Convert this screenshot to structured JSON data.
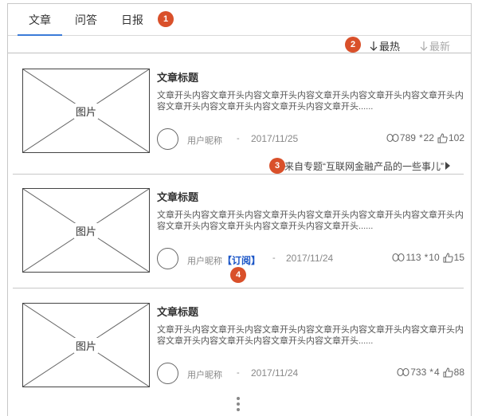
{
  "tabs": [
    {
      "label": "文章",
      "active": true
    },
    {
      "label": "问答",
      "active": false
    },
    {
      "label": "日报",
      "active": false
    }
  ],
  "markers": [
    "1",
    "2",
    "3",
    "4"
  ],
  "sort": {
    "hot_label": "最热",
    "new_label": "最新"
  },
  "articles": [
    {
      "image_label": "图片",
      "title": "文章标题",
      "excerpt": "文章开头内容文章开头内容文章开头内容文章开头内容文章开头内容文章开头内容文章开头内容文章开头内容文章开头内容文章开头......",
      "nickname": "用户昵称",
      "dash": "-",
      "date": "2017/11/25",
      "views": "789",
      "stars": "22",
      "likes": "102",
      "source": "来自专题“互联网金融产品的一些事儿”"
    },
    {
      "image_label": "图片",
      "title": "文章标题",
      "excerpt": "文章开头内容文章开头内容文章开头内容文章开头内容文章开头内容文章开头内容文章开头内容文章开头内容文章开头内容文章开头......",
      "nickname": "用户昵称",
      "subscribe": "【订阅】",
      "dash": "-",
      "date": "2017/11/24",
      "views": "113",
      "stars": "10",
      "likes": "15"
    },
    {
      "image_label": "图片",
      "title": "文章标题",
      "excerpt": "文章开头内容文章开头内容文章开头内容文章开头内容文章开头内容文章开头内容文章开头内容文章开头内容文章开头内容文章开头......",
      "nickname": "用户昵称",
      "dash": "-",
      "date": "2017/11/24",
      "views": "733",
      "stars": "4",
      "likes": "88"
    }
  ],
  "colors": {
    "accent": "#3b7bd8",
    "marker": "#d9502a",
    "subscribe": "#1a55c7"
  },
  "icons": {
    "views": "views-icon",
    "stars": "star-icon",
    "likes": "thumbs-up-icon",
    "sort": "arrow-down-icon",
    "more": "vertical-ellipsis-icon"
  }
}
